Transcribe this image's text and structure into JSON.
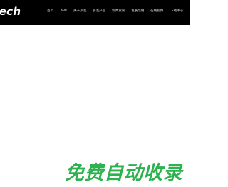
{
  "brand": {
    "logo_text": "tech"
  },
  "nav": {
    "items": [
      {
        "label": "首页"
      },
      {
        "label": "APP"
      },
      {
        "label": "关于多准"
      },
      {
        "label": "多准产品"
      },
      {
        "label": "新闻资讯"
      },
      {
        "label": "发展案例"
      },
      {
        "label": "在线视频"
      },
      {
        "label": "下载中心"
      }
    ]
  },
  "hero": {
    "headline": "免费自动收录"
  },
  "colors": {
    "navbar_bg": "#000000",
    "page_bg": "#ffffff",
    "accent_green": "#2eb24f"
  }
}
